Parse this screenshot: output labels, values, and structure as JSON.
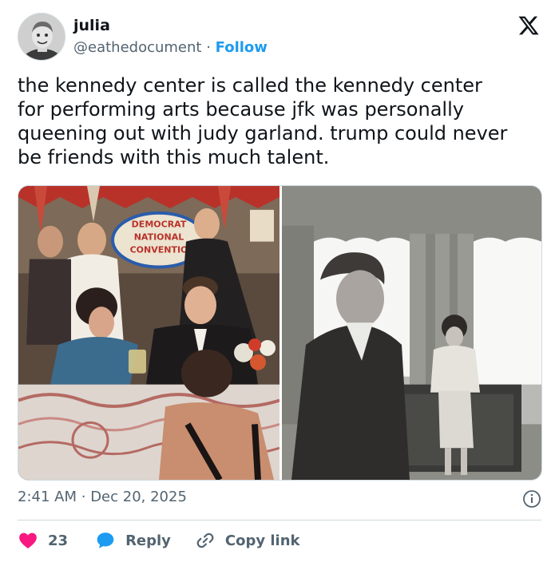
{
  "author": {
    "name": "julia",
    "handle": "@eathedocument",
    "separator": "·",
    "follow_label": "Follow",
    "avatar_icon": "avatar-photo"
  },
  "brand": {
    "logo_icon": "x-logo-icon"
  },
  "tweet": {
    "text": "the kennedy center is called the kennedy center\nfor performing arts because jfk was personally\nqueening out with judy garland. trump could never\nbe friends with this much talent."
  },
  "media": {
    "left_photo_sign": [
      "DEMOCRAT",
      "NATIONAL",
      "CONVENTIO"
    ]
  },
  "meta": {
    "time": "2:41 AM",
    "separator": "·",
    "date": "Dec 20, 2025",
    "info_icon": "info-icon"
  },
  "actions": {
    "like_count": "23",
    "like_icon": "heart-icon",
    "reply_label": "Reply",
    "reply_icon": "speech-bubble-icon",
    "copy_label": "Copy link",
    "copy_icon": "link-icon"
  },
  "colors": {
    "accent": "#1d9bf0",
    "like": "#f91880",
    "text": "#0f1419",
    "secondary": "#536471",
    "border": "#cfd9de"
  }
}
